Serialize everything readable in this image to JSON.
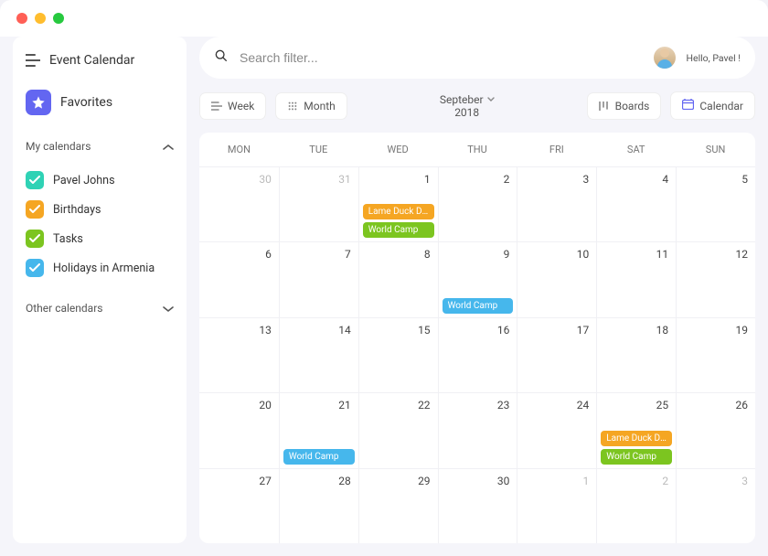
{
  "sidebar": {
    "title": "Event Calendar",
    "favorites_label": "Favorites",
    "sections": {
      "my": "My calendars",
      "other": "Other calendars"
    },
    "calendars": [
      {
        "label": "Pavel Johns",
        "color": "#2fd2b5"
      },
      {
        "label": "Birthdays",
        "color": "#f5a623"
      },
      {
        "label": "Tasks",
        "color": "#7cc520"
      },
      {
        "label": "Holidays in Armenia",
        "color": "#46b7ec"
      }
    ]
  },
  "topbar": {
    "search_placeholder": "Search filter...",
    "greeting": "Hello, Pavel !"
  },
  "controls": {
    "week": "Week",
    "month": "Month",
    "boards": "Boards",
    "calendar": "Calendar",
    "period_month": "Septeber",
    "period_year": "2018"
  },
  "dows": [
    "MON",
    "TUE",
    "WED",
    "THU",
    "FRI",
    "SAT",
    "SUN"
  ],
  "events": {
    "lame": "Lame Duck Day",
    "world": "World Camp"
  },
  "cells": [
    {
      "n": "30",
      "muted": true
    },
    {
      "n": "31",
      "muted": true
    },
    {
      "n": "1",
      "ev": [
        {
          "t": "lame",
          "c": "orange"
        },
        {
          "t": "world",
          "c": "green"
        }
      ]
    },
    {
      "n": "2"
    },
    {
      "n": "3"
    },
    {
      "n": "4"
    },
    {
      "n": "5"
    },
    {
      "n": "6"
    },
    {
      "n": "7"
    },
    {
      "n": "8"
    },
    {
      "n": "9",
      "ev": [
        {
          "t": "world",
          "c": "blue"
        }
      ]
    },
    {
      "n": "10"
    },
    {
      "n": "11"
    },
    {
      "n": "12"
    },
    {
      "n": "13"
    },
    {
      "n": "14"
    },
    {
      "n": "15"
    },
    {
      "n": "16"
    },
    {
      "n": "17"
    },
    {
      "n": "18"
    },
    {
      "n": "19"
    },
    {
      "n": "20"
    },
    {
      "n": "21",
      "ev": [
        {
          "t": "world",
          "c": "blue"
        }
      ]
    },
    {
      "n": "22"
    },
    {
      "n": "23"
    },
    {
      "n": "24"
    },
    {
      "n": "25",
      "ev": [
        {
          "t": "lame",
          "c": "orange"
        },
        {
          "t": "world",
          "c": "green"
        }
      ]
    },
    {
      "n": "26"
    },
    {
      "n": "27"
    },
    {
      "n": "28"
    },
    {
      "n": "29"
    },
    {
      "n": "30"
    },
    {
      "n": "1",
      "muted": true
    },
    {
      "n": "2",
      "muted": true
    },
    {
      "n": "3",
      "muted": true
    }
  ]
}
